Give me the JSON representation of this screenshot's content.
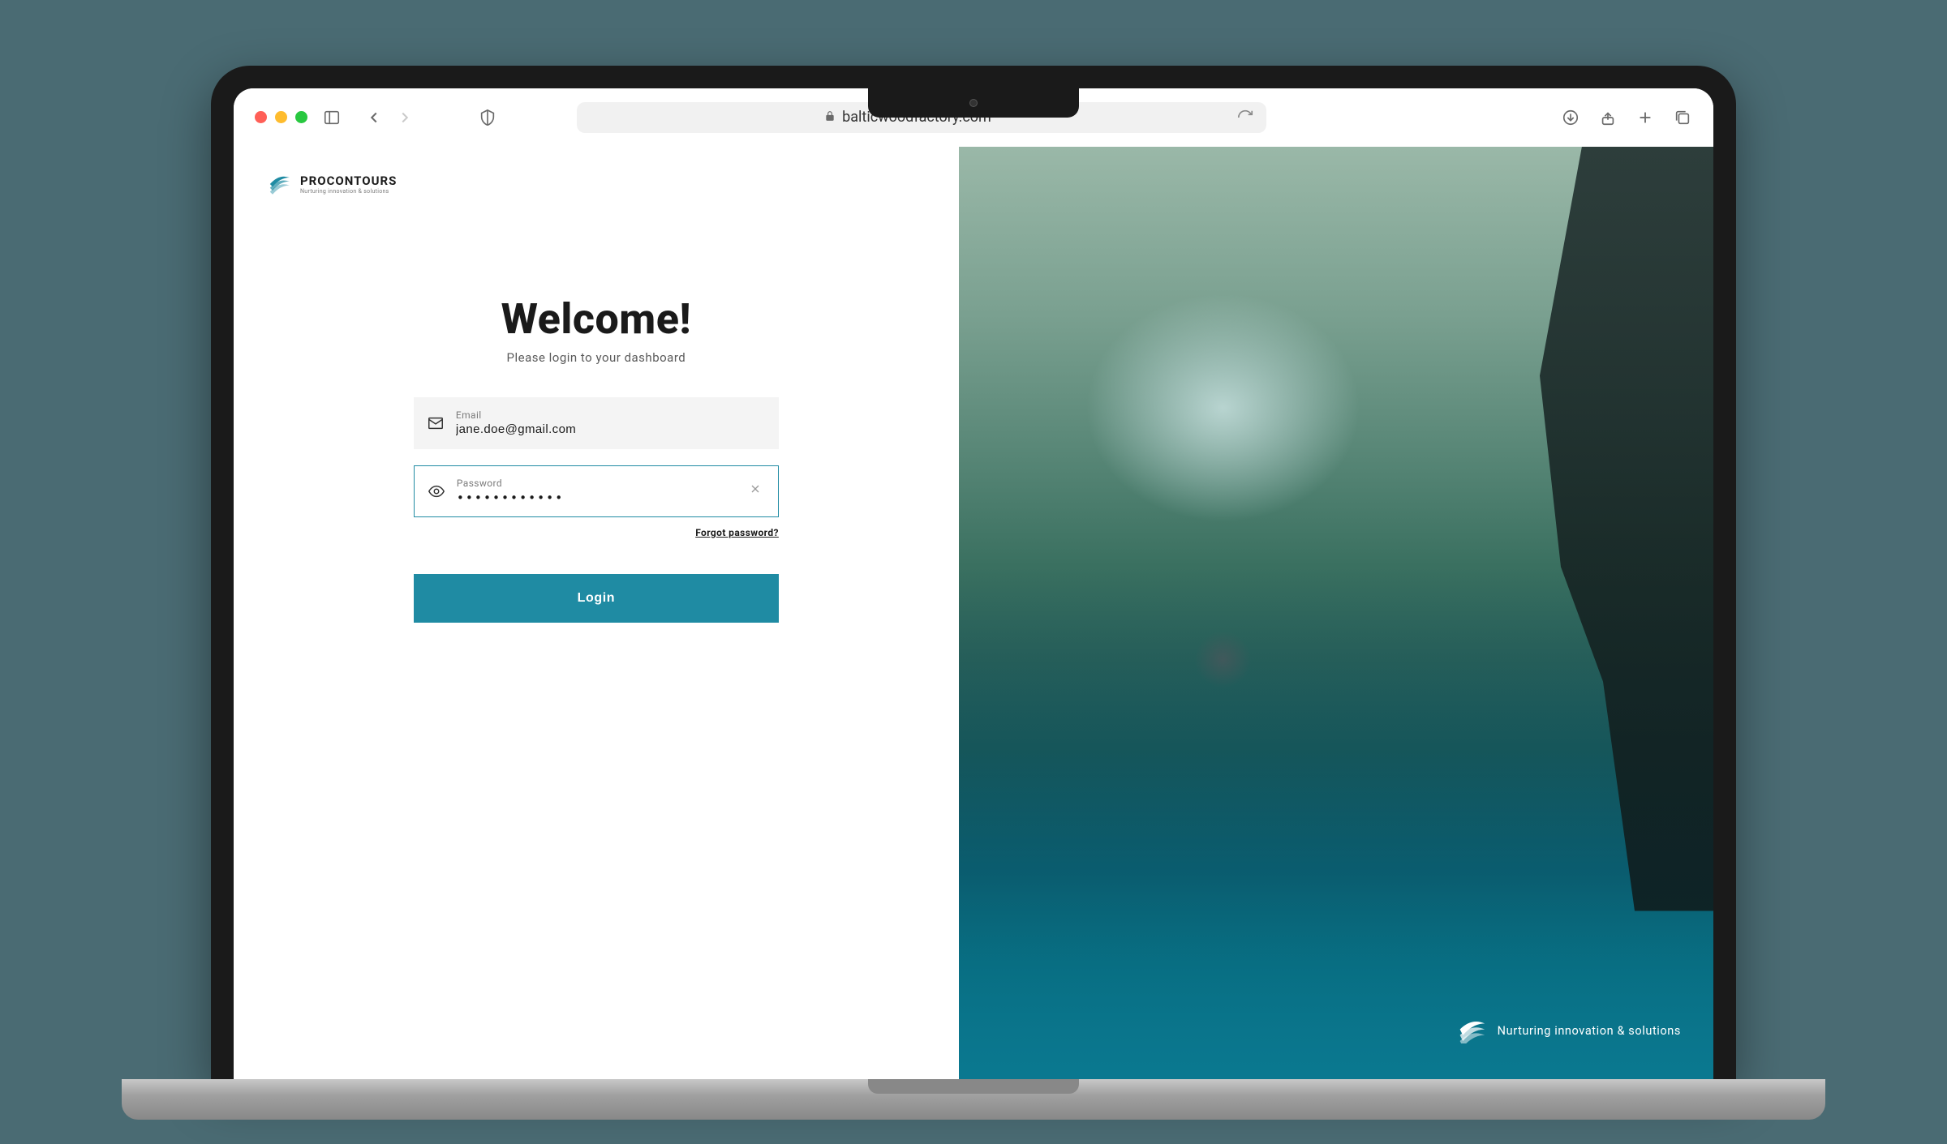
{
  "browser": {
    "url": "balticwoodfactory.com"
  },
  "brand": {
    "name": "PROCONTOURS",
    "tagline": "Nurturing innovation & solutions",
    "accent_color": "#1f8ba3"
  },
  "login": {
    "welcome_title": "Welcome!",
    "welcome_subtitle": "Please login to your dashboard",
    "email_label": "Email",
    "email_value": "jane.doe@gmail.com",
    "password_label": "Password",
    "password_value": "••••••••••••",
    "forgot_label": "Forgot password?",
    "submit_label": "Login"
  },
  "hero_footer": {
    "tagline": "Nurturing innovation & solutions"
  }
}
